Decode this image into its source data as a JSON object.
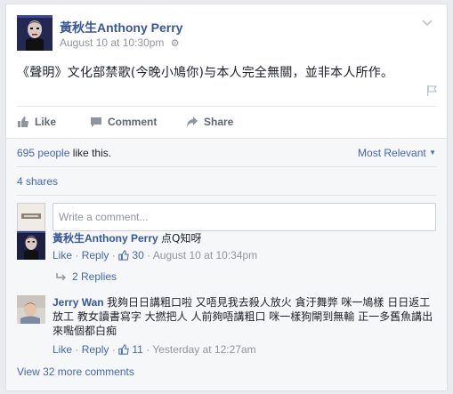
{
  "post": {
    "author": "黃秋生Anthony Perry",
    "timestamp": "August 10 at 10:30pm",
    "privacy_icon": "gear-icon",
    "text": "《聲明》文化部禁歌(今晚小鳩你)与本人完全無關，並非本人所作。"
  },
  "actions": {
    "like": "Like",
    "comment": "Comment",
    "share": "Share"
  },
  "stats": {
    "likes_count": "695 people",
    "likes_suffix": " like this.",
    "sort_label": "Most Relevant",
    "shares": "4 shares"
  },
  "composer": {
    "placeholder": "Write a comment..."
  },
  "comments": [
    {
      "author": "黃秋生Anthony Perry",
      "text": "点Q知呀",
      "like_label": "Like",
      "reply_label": "Reply",
      "likes": "30",
      "timestamp": "August 10 at 10:34pm"
    },
    {
      "author": "Jerry Wan",
      "text": "我夠日日講粗口啦 又唔見我去殺人放火 貪汙舞弊 咪一鳩樣 日日返工放工 教女讀書寫字 大撚把人 人前夠唔講粗口 咪一樣狗閘到無輸 正一多舊魚講出來嚸個都白痴",
      "like_label": "Like",
      "reply_label": "Reply",
      "likes": "11",
      "timestamp": "Yesterday at 12:27am"
    }
  ],
  "replies_label": "2 Replies",
  "more_comments": "View 32 more comments",
  "colors": {
    "link": "#4267b2",
    "author": "#365899",
    "muted": "#90949c",
    "background": "#e9ebee"
  }
}
